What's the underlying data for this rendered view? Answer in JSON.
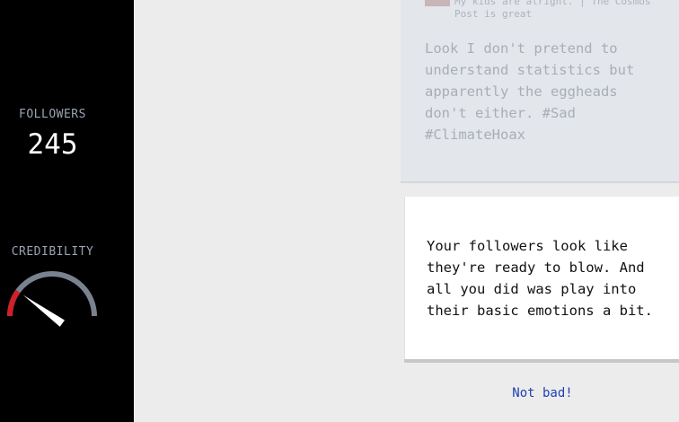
{
  "stats": {
    "followers_label": "FOLLOWERS",
    "followers_value": "245",
    "credibility_label": "CREDIBILITY",
    "credibility_level": 0.2
  },
  "post": {
    "headline_line1": "My kids are alright. | The Cosmos",
    "headline_line2": "Post is great",
    "body": "Look I don't pretend to\nunderstand statistics but\napparently the eggheads\ndon't either. #Sad\n#ClimateHoax"
  },
  "message": {
    "text": "Your followers look like\nthey're ready to blow. And\nall you did was play into\ntheir basic emotions a bit."
  },
  "actions": {
    "continue_label": "Not bad!"
  },
  "colors": {
    "sidebar_bg": "#000000",
    "gauge_track": "#7a8290",
    "gauge_danger": "#d0202a",
    "link": "#1f3fb0"
  }
}
